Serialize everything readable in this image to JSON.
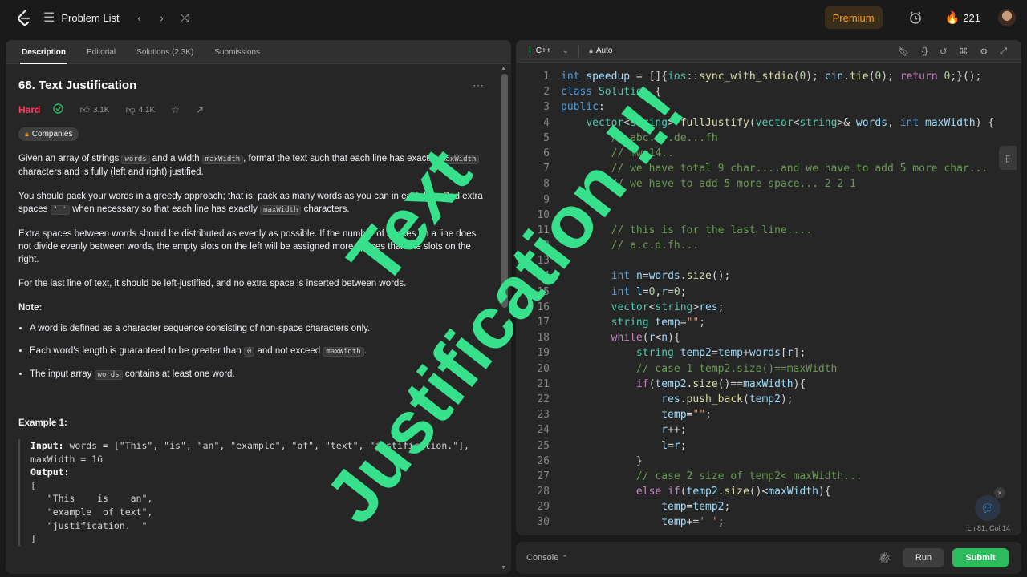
{
  "topbar": {
    "problem_list_label": "Problem List",
    "premium_label": "Premium",
    "streak_count": "221"
  },
  "left": {
    "tabs": [
      "Description",
      "Editorial",
      "Solutions (2.3K)",
      "Submissions"
    ],
    "title": "68. Text Justification",
    "difficulty": "Hard",
    "likes": "3.1K",
    "dislikes": "4.1K",
    "companies_label": "Companies",
    "p1": {
      "a": "Given an array of strings ",
      "c1": "words",
      "b": " and a width ",
      "c2": "maxWidth",
      "c": ", format the text such that each line has exactly ",
      "c3": "maxWidth",
      "d": " characters and is fully (left and right) justified."
    },
    "p2": {
      "a": "You should pack your words in a greedy approach; that is, pack as many words as you can in each line. Pad extra spaces ",
      "c1": "' '",
      "b": " when necessary so that each line has exactly ",
      "c2": "maxWidth",
      "c": " characters."
    },
    "p3": "Extra spaces between words should be distributed as evenly as possible. If the number of spaces on a line does not divide evenly between words, the empty slots on the left will be assigned more spaces than the slots on the right.",
    "p4": "For the last line of text, it should be left-justified, and no extra space is inserted between words.",
    "note_title": "Note:",
    "notes": [
      {
        "a": "A word is defined as a character sequence consisting of non-space characters only."
      },
      {
        "a": "Each word's length is guaranteed to be greater than ",
        "c1": "0",
        "b": " and not exceed ",
        "c2": "maxWidth",
        "c": "."
      },
      {
        "a": "The input array ",
        "c1": "words",
        "b": " contains at least one word."
      }
    ],
    "example_title": "Example 1:",
    "example": {
      "input_label": "Input:",
      "input_line1": " words = [\"This\", \"is\", \"an\", \"example\", \"of\", \"text\", \"justification.\"],",
      "input_line2": "maxWidth = 16",
      "output_label": "Output:",
      "output_lines": [
        "[",
        "   \"This    is    an\",",
        "   \"example  of text\",",
        "   \"justification.  \"",
        "]"
      ]
    }
  },
  "editor": {
    "language": "C++",
    "mode": "Auto",
    "status": "Ln 81, Col 14",
    "lines": [
      {
        "n": "1",
        "h": "<span class='kw'>int</span> <span class='vr'>speedup</span> = []{<span class='ty'>ios</span>::<span class='fn'>sync_with_stdio</span>(<span class='nm'>0</span>); <span class='vr'>cin</span>.<span class='fn'>tie</span>(<span class='nm'>0</span>); <span class='pu'>return</span> <span class='nm'>0</span>;}();"
      },
      {
        "n": "2",
        "h": "<span class='kw'>class</span> <span class='ty'>Solution</span> {"
      },
      {
        "n": "3",
        "h": "<span class='kw'>public</span>:"
      },
      {
        "n": "4",
        "h": "    <span class='ty'>vector</span>&lt;<span class='ty'>string</span>&gt; <span class='fn'>fullJustify</span>(<span class='ty'>vector</span>&lt;<span class='ty'>string</span>&gt;&amp; <span class='vr'>words</span>, <span class='kw'>int</span> <span class='vr'>maxWidth</span>) {"
      },
      {
        "n": "5",
        "h": "        <span class='cm'>// abc....de...fh</span>"
      },
      {
        "n": "6",
        "h": "        <span class='cm'>// mw=14..</span>"
      },
      {
        "n": "7",
        "h": "        <span class='cm'>// we have total 9 char....and we have to add 5 more char...</span>"
      },
      {
        "n": "8",
        "h": "        <span class='cm'>// we have to add 5 more space... 2 2 1</span>"
      },
      {
        "n": "9",
        "h": ""
      },
      {
        "n": "10",
        "h": ""
      },
      {
        "n": "11",
        "h": "        <span class='cm'>// this is for the last line....</span>"
      },
      {
        "n": "12",
        "h": "        <span class='cm'>// a.c.d.fh...</span>"
      },
      {
        "n": "13",
        "h": ""
      },
      {
        "n": "14",
        "h": "        <span class='kw'>int</span> <span class='vr'>n</span>=<span class='vr'>words</span>.<span class='fn'>size</span>();"
      },
      {
        "n": "15",
        "h": "        <span class='kw'>int</span> <span class='vr'>l</span>=<span class='nm'>0</span>,<span class='vr'>r</span>=<span class='nm'>0</span>;"
      },
      {
        "n": "16",
        "h": "        <span class='ty'>vector</span>&lt;<span class='ty'>string</span>&gt;<span class='vr'>res</span>;"
      },
      {
        "n": "17",
        "h": "        <span class='ty'>string</span> <span class='vr'>temp</span>=<span class='st'>\"\"</span>;"
      },
      {
        "n": "18",
        "h": "        <span class='pu'>while</span>(<span class='vr'>r</span>&lt;<span class='vr'>n</span>){"
      },
      {
        "n": "19",
        "h": "            <span class='ty'>string</span> <span class='vr'>temp2</span>=<span class='vr'>temp</span>+<span class='vr'>words</span>[<span class='vr'>r</span>];"
      },
      {
        "n": "20",
        "h": "            <span class='cm'>// case 1 temp2.size()==maxWidth</span>"
      },
      {
        "n": "21",
        "h": "            <span class='pu'>if</span>(<span class='vr'>temp2</span>.<span class='fn'>size</span>()==<span class='vr'>maxWidth</span>){"
      },
      {
        "n": "22",
        "h": "                <span class='vr'>res</span>.<span class='fn'>push_back</span>(<span class='vr'>temp2</span>);"
      },
      {
        "n": "23",
        "h": "                <span class='vr'>temp</span>=<span class='st'>\"\"</span>;"
      },
      {
        "n": "24",
        "h": "                <span class='vr'>r</span>++;"
      },
      {
        "n": "25",
        "h": "                <span class='vr'>l</span>=<span class='vr'>r</span>;"
      },
      {
        "n": "26",
        "h": "            }"
      },
      {
        "n": "27",
        "h": "            <span class='cm'>// case 2 size of temp2&lt; maxWidth...</span>"
      },
      {
        "n": "28",
        "h": "            <span class='pu'>else</span> <span class='pu'>if</span>(<span class='vr'>temp2</span>.<span class='fn'>size</span>()&lt;<span class='vr'>maxWidth</span>){"
      },
      {
        "n": "29",
        "h": "                <span class='vr'>temp</span>=<span class='vr'>temp2</span>;"
      },
      {
        "n": "30",
        "h": "                <span class='vr'>temp</span>+=<span class='st'>' '</span>;"
      }
    ]
  },
  "console": {
    "label": "Console",
    "run_label": "Run",
    "submit_label": "Submit"
  },
  "overlay": {
    "line1": "Text",
    "line2": "Justification !!!",
    "color": "#37e08a"
  }
}
